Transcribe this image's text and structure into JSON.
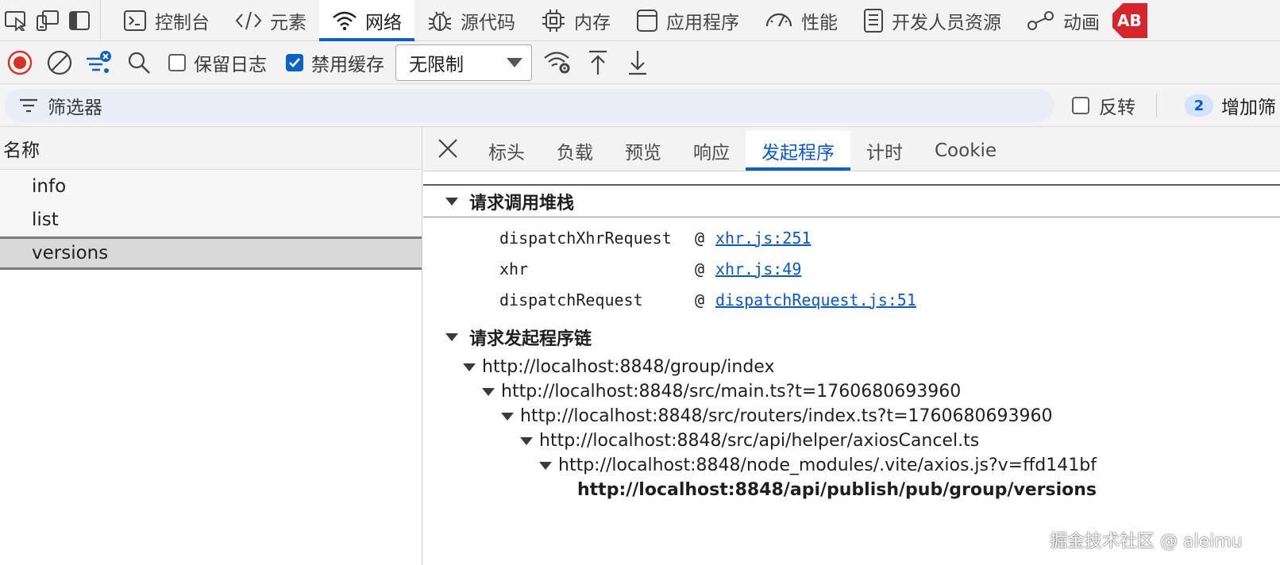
{
  "topbar": {
    "tabs": [
      {
        "label": "控制台",
        "icon": "console-icon"
      },
      {
        "label": "元素",
        "icon": "code-icon"
      },
      {
        "label": "网络",
        "icon": "wifi-icon"
      },
      {
        "label": "源代码",
        "icon": "bug-icon"
      },
      {
        "label": "内存",
        "icon": "chip-icon"
      },
      {
        "label": "应用程序",
        "icon": "application-icon"
      },
      {
        "label": "性能",
        "icon": "performance-gauge-icon"
      },
      {
        "label": "开发人员资源",
        "icon": "document-icon"
      },
      {
        "label": "动画",
        "icon": "animation-icon"
      }
    ],
    "active_tab": "网络",
    "extension_badge": "AB"
  },
  "toolbar": {
    "preserve_log_label": "保留日志",
    "preserve_log_checked": false,
    "disable_cache_label": "禁用缓存",
    "disable_cache_checked": true,
    "throttling_value": "无限制"
  },
  "filter": {
    "placeholder": "筛选器",
    "invert_label": "反转",
    "more_filters_count": "2",
    "more_filters_label": "增加筛"
  },
  "requests": {
    "column_header": "名称",
    "items": [
      "info",
      "list",
      "versions"
    ],
    "selected": "versions"
  },
  "details": {
    "tabs": [
      "标头",
      "负载",
      "预览",
      "响应",
      "发起程序",
      "计时",
      "Cookie"
    ],
    "active_tab": "发起程序",
    "call_stack": {
      "title": "请求调用堆栈",
      "frames": [
        {
          "fn": "dispatchXhrRequest",
          "at": "@",
          "loc": "xhr.js:251"
        },
        {
          "fn": "xhr",
          "at": "@",
          "loc": "xhr.js:49"
        },
        {
          "fn": "dispatchRequest",
          "at": "@",
          "loc": "dispatchRequest.js:51"
        }
      ]
    },
    "initiator_chain": {
      "title": "请求发起程序链",
      "nodes": [
        "http://localhost:8848/group/index",
        "http://localhost:8848/src/main.ts?t=1760680693960",
        "http://localhost:8848/src/routers/index.ts?t=1760680693960",
        "http://localhost:8848/src/api/helper/axiosCancel.ts",
        "http://localhost:8848/node_modules/.vite/axios.js?v=ffd141bf",
        "http://localhost:8848/api/publish/pub/group/versions"
      ]
    }
  },
  "watermark": "掘金技术社区 @ aleimu",
  "colors": {
    "accent": "#0c61c5",
    "record": "#d93025",
    "link": "#0b57d0",
    "abp": "#d5262e"
  }
}
